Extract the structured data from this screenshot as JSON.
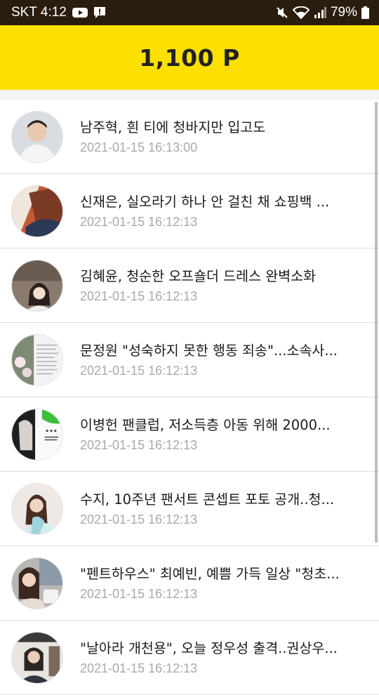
{
  "status_bar": {
    "carrier_time": "SKT 4:12",
    "battery": "79%"
  },
  "header": {
    "points": "1,100 P"
  },
  "articles": [
    {
      "title": "남주혁, 흰 티에 청바지만 입고도",
      "date": "2021-01-15 16:13:00"
    },
    {
      "title": "신재은, 실오라기 하나 안 걸친 채 쇼핑백 ...",
      "date": "2021-01-15 16:12:13"
    },
    {
      "title": "김혜윤, 청순한 오프숄더 드레스 완벽소화",
      "date": "2021-01-15 16:12:13"
    },
    {
      "title": "문정원 \"성숙하지 못한 행동 죄송\"...소속사...",
      "date": "2021-01-15 16:12:13"
    },
    {
      "title": "이병헌 팬클럽, 저소득층 아동 위해 2000...",
      "date": "2021-01-15 16:12:13"
    },
    {
      "title": "수지, 10주년 팬서트 콘셉트 포토 공개..청...",
      "date": "2021-01-15 16:12:13"
    },
    {
      "title": "\"펜트하우스\" 최예빈, 예쁨 가득 일상 \"청초...",
      "date": "2021-01-15 16:12:13"
    },
    {
      "title": "\"날아라 개천용\", 오늘 정우성 출격..권상우...",
      "date": "2021-01-15 16:12:13"
    }
  ]
}
